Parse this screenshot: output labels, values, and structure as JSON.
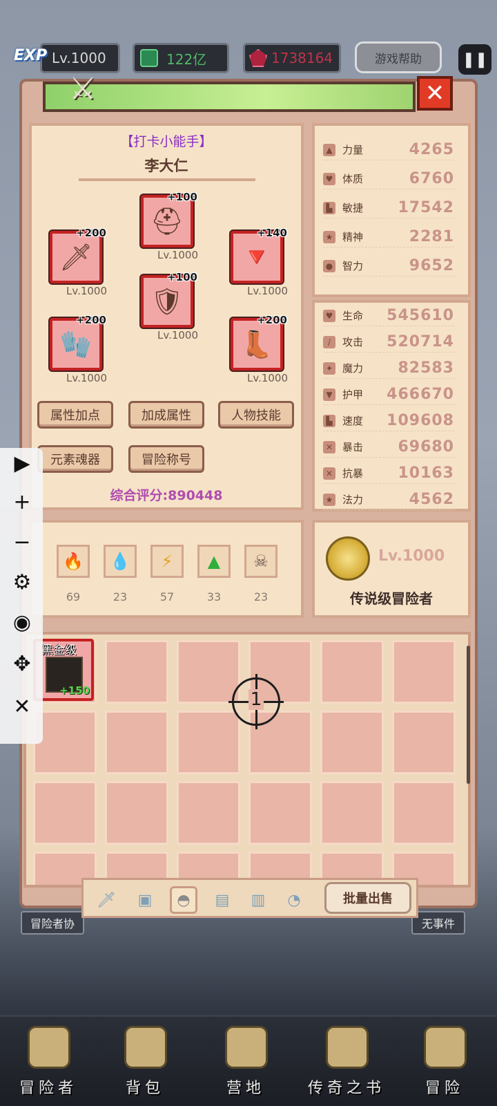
{
  "hud": {
    "exp_label": "EXP",
    "level": "Lv.1000",
    "gems": "122亿",
    "rubies": "1738164",
    "help_label": "游戏帮助",
    "pause_icon": "pause-icon"
  },
  "character": {
    "title": "【打卡小能手】",
    "name": "李大仁",
    "equipment": [
      {
        "slot": "weapon",
        "plus": "+200",
        "level": "Lv.1000"
      },
      {
        "slot": "helmet",
        "plus": "+100",
        "level": "Lv.1000"
      },
      {
        "slot": "amulet",
        "plus": "+140",
        "level": "Lv.1000"
      },
      {
        "slot": "armor",
        "plus": "+100",
        "level": "Lv.1000"
      },
      {
        "slot": "gloves",
        "plus": "+200",
        "level": "Lv.1000"
      },
      {
        "slot": "boots",
        "plus": "+200",
        "level": "Lv.1000"
      }
    ],
    "buttons": [
      "属性加点",
      "加成属性",
      "人物技能",
      "元素魂器",
      "冒险称号"
    ],
    "score_label": "综合评分:890448"
  },
  "base_stats": [
    {
      "name": "力量",
      "value": "4265"
    },
    {
      "name": "体质",
      "value": "6760"
    },
    {
      "name": "敏捷",
      "value": "17542"
    },
    {
      "name": "精神",
      "value": "2281"
    },
    {
      "name": "智力",
      "value": "9652"
    }
  ],
  "combat_stats": [
    {
      "name": "生命",
      "value": "545610"
    },
    {
      "name": "攻击",
      "value": "520714"
    },
    {
      "name": "魔力",
      "value": "82583"
    },
    {
      "name": "护甲",
      "value": "466670"
    },
    {
      "name": "速度",
      "value": "109608"
    },
    {
      "name": "暴击",
      "value": "69680"
    },
    {
      "name": "抗暴",
      "value": "10163"
    },
    {
      "name": "法力",
      "value": "4562"
    }
  ],
  "elements": [
    {
      "icon": "fire-icon",
      "count": "69"
    },
    {
      "icon": "water-icon",
      "count": "23"
    },
    {
      "icon": "lightning-icon",
      "count": "57"
    },
    {
      "icon": "leaf-icon",
      "count": "33"
    },
    {
      "icon": "skull-icon",
      "count": "23"
    }
  ],
  "rank": {
    "level": "Lv.1000",
    "name": "传说级冒险者"
  },
  "inventory": {
    "item": {
      "grade": "黑金级",
      "bonus": "+150"
    },
    "cursor_number": "1"
  },
  "tabs": {
    "sell_label": "批量出售",
    "left_label": "冒险者协",
    "right_label": "无事件"
  },
  "nav": [
    {
      "label": "冒险者"
    },
    {
      "label": "背包"
    },
    {
      "label": "营地"
    },
    {
      "label": "传奇之书"
    },
    {
      "label": "冒险"
    }
  ],
  "colors": {
    "slot_border": "#c42222",
    "stat_value": "#c9938a",
    "score": "#b04db0",
    "title": "#8a2cc8"
  }
}
